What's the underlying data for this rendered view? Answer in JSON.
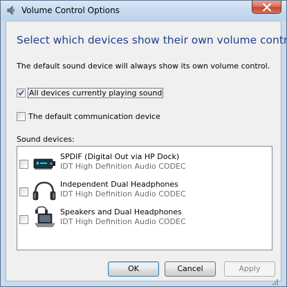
{
  "window": {
    "title": "Volume Control Options",
    "title_icon": "speaker-icon",
    "close_icon": "close-icon"
  },
  "heading": "Select which devices show their own volume control",
  "description": "The default sound device will always show its own volume control.",
  "options": [
    {
      "label": "All devices currently playing sound",
      "checked": true
    },
    {
      "label": "The default communication device",
      "checked": false
    }
  ],
  "section_label": "Sound devices:",
  "devices": [
    {
      "name": "SPDIF (Digital Out via HP Dock)",
      "subtitle": "IDT High Definition Audio CODEC",
      "checked": false,
      "icon": "digital-output-icon"
    },
    {
      "name": "Independent Dual Headphones",
      "subtitle": "IDT High Definition Audio CODEC",
      "checked": false,
      "icon": "headphones-icon"
    },
    {
      "name": "Speakers and Dual Headphones",
      "subtitle": "IDT High Definition Audio CODEC",
      "checked": false,
      "icon": "laptop-speakers-icon"
    }
  ],
  "buttons": {
    "ok": "OK",
    "cancel": "Cancel",
    "apply": "Apply"
  },
  "colors": {
    "heading": "#1e3f8f",
    "close_button": "#c24a33",
    "frame": "#c9dbee"
  }
}
